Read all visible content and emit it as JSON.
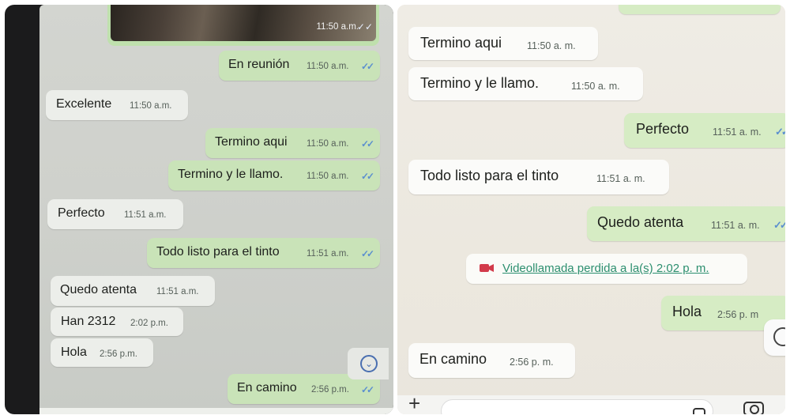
{
  "left_chat": {
    "photo_time": "11:50 a.m.",
    "messages": [
      {
        "text": "En reunión",
        "time": "11:50 a.m.",
        "dir": "out",
        "status": "read"
      },
      {
        "text": "Excelente",
        "time": "11:50 a.m.",
        "dir": "in"
      },
      {
        "text": "Termino aqui",
        "time": "11:50 a.m.",
        "dir": "out",
        "status": "read"
      },
      {
        "text": "Termino y le llamo.",
        "time": "11:50 a.m.",
        "dir": "out",
        "status": "read"
      },
      {
        "text": "Perfecto",
        "time": "11:51 a.m.",
        "dir": "in"
      },
      {
        "text": "Todo listo para el tinto",
        "time": "11:51 a.m.",
        "dir": "out",
        "status": "read"
      },
      {
        "text": "Quedo atenta",
        "time": "11:51 a.m.",
        "dir": "in"
      },
      {
        "text": "Han 2312",
        "time": "2:02 p.m.",
        "dir": "in"
      },
      {
        "text": "Hola",
        "time": "2:56 p.m.",
        "dir": "in"
      },
      {
        "text": "En camino",
        "time": "2:56 p.m.",
        "dir": "out",
        "status": "read"
      }
    ],
    "scroll_icon": "chevron-down-icon"
  },
  "right_chat": {
    "messages": [
      {
        "text": "Termino aqui",
        "time": "11:50 a. m.",
        "dir": "in"
      },
      {
        "text": "Termino y le llamo.",
        "time": "11:50 a. m.",
        "dir": "in"
      },
      {
        "text": "Perfecto",
        "time": "11:51 a. m.",
        "dir": "out",
        "status": "read"
      },
      {
        "text": "Todo listo para el tinto",
        "time": "11:51 a. m.",
        "dir": "in"
      },
      {
        "text": "Quedo atenta",
        "time": "11:51 a. m.",
        "dir": "out",
        "status": "read"
      },
      {
        "text": "Hola",
        "time": "2:56 p. m",
        "dir": "out"
      },
      {
        "text": "En camino",
        "time": "2:56 p. m.",
        "dir": "in"
      }
    ],
    "missed_call": "Videollamada perdida a la(s) 2:02 p. m.",
    "input_bar": {
      "plus": "+",
      "icons": [
        "plus-icon",
        "sticker-icon",
        "camera-icon"
      ]
    }
  },
  "colors": {
    "out_bubble": "#c9e3b8",
    "in_bubble": "#eceeea",
    "read_ticks": "#5b8fcf",
    "missed_call_link": "#2c8f6f",
    "missed_call_icon": "#d23a4a"
  },
  "tick_glyph": "✓✓"
}
